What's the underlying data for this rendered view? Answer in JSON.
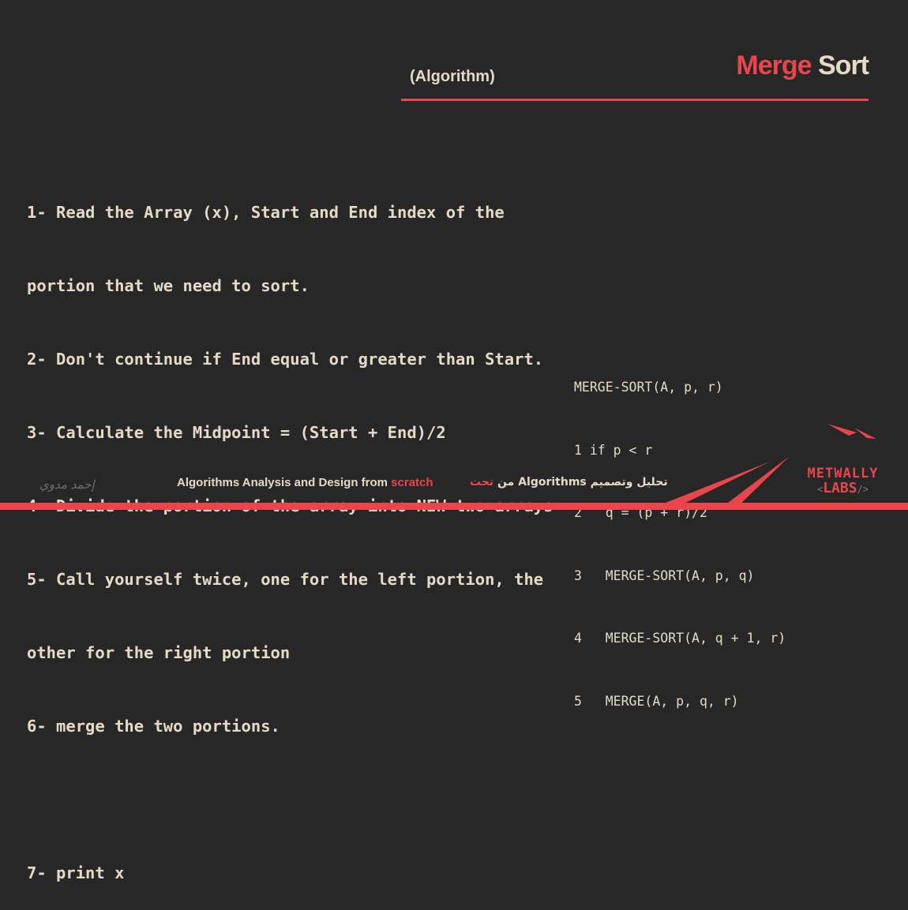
{
  "header": {
    "title_red": "Merge",
    "title_rest": "Sort",
    "subtitle": "(Algorithm)"
  },
  "steps": [
    "1- Read the Array (x), Start and End index of the",
    "portion that we need to sort.",
    "2- Don't continue if End equal or greater than Start.",
    "3- Calculate the Midpoint = (Start + End)/2",
    "4- Divide the portion of the array into NEW two arrays",
    "5- Call yourself twice, one for the left portion, the",
    "other for the right portion",
    "6- merge the two portions.",
    "",
    "7- print x"
  ],
  "pseudocode": [
    "MERGE-SORT(A, p, r)",
    "1 if p < r",
    "2   q = (p + r)/2",
    "3   MERGE-SORT(A, p, q)",
    "4   MERGE-SORT(A, q + 1, r)",
    "5   MERGE(A, p, q, r)"
  ],
  "footer": {
    "course_text": "Algorithms Analysis and Design from ",
    "course_highlight": "scratch",
    "arabic_text": "تحليل وتصميم Algorithms من ",
    "arabic_highlight": "تحت",
    "signature": "إحمد مدوي"
  },
  "logo": {
    "line1": "METWALLY",
    "line2": "LABS",
    "bracket_left": "<",
    "bracket_right": "/>"
  },
  "colors": {
    "background": "#272727",
    "accent": "#e8464c",
    "text": "#e6dac6"
  }
}
